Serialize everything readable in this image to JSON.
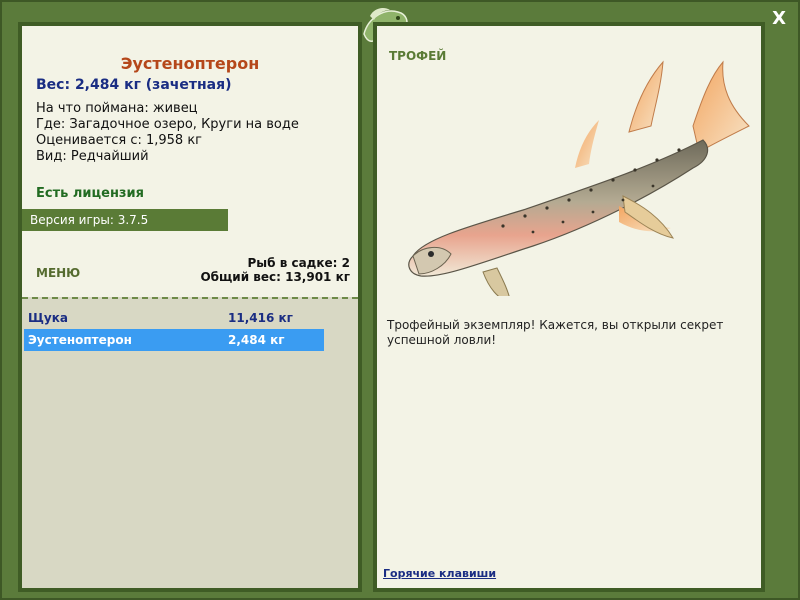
{
  "window": {
    "close_label": "X"
  },
  "left": {
    "fish_name": "Эустеноптерон",
    "weight": "Вес: 2,484 кг (зачетная)",
    "caught_with": "На что поймана: живец",
    "where": "Где: Загадочное озеро, Круги на воде",
    "valued_from": "Оценивается с: 1,958 кг",
    "kind": "Вид: Редчайший",
    "license": "Есть лицензия",
    "version": "Версия игры: 3.7.5",
    "menu_label": "МЕНЮ",
    "cage_count": "Рыб в садке: 2",
    "cage_total_weight": "Общий вес: 13,901 кг",
    "list": [
      {
        "name": "Щука",
        "weight": "11,416 кг",
        "selected": false
      },
      {
        "name": "Эустеноптерон",
        "weight": "2,484 кг",
        "selected": true
      }
    ]
  },
  "right": {
    "trophy_label": "ТРОФЕЙ",
    "description": "Трофейный экземпляр! Кажется, вы открыли секрет успешной ловли!",
    "hotkeys_label": "Горячие клавиши"
  },
  "colors": {
    "frame": "#5b7b3b",
    "panel_bg": "#f3f3e6",
    "fish_name": "#b5471a",
    "weight_text": "#1a2d83",
    "license": "#226b22",
    "selection": "#3a9cf2"
  }
}
